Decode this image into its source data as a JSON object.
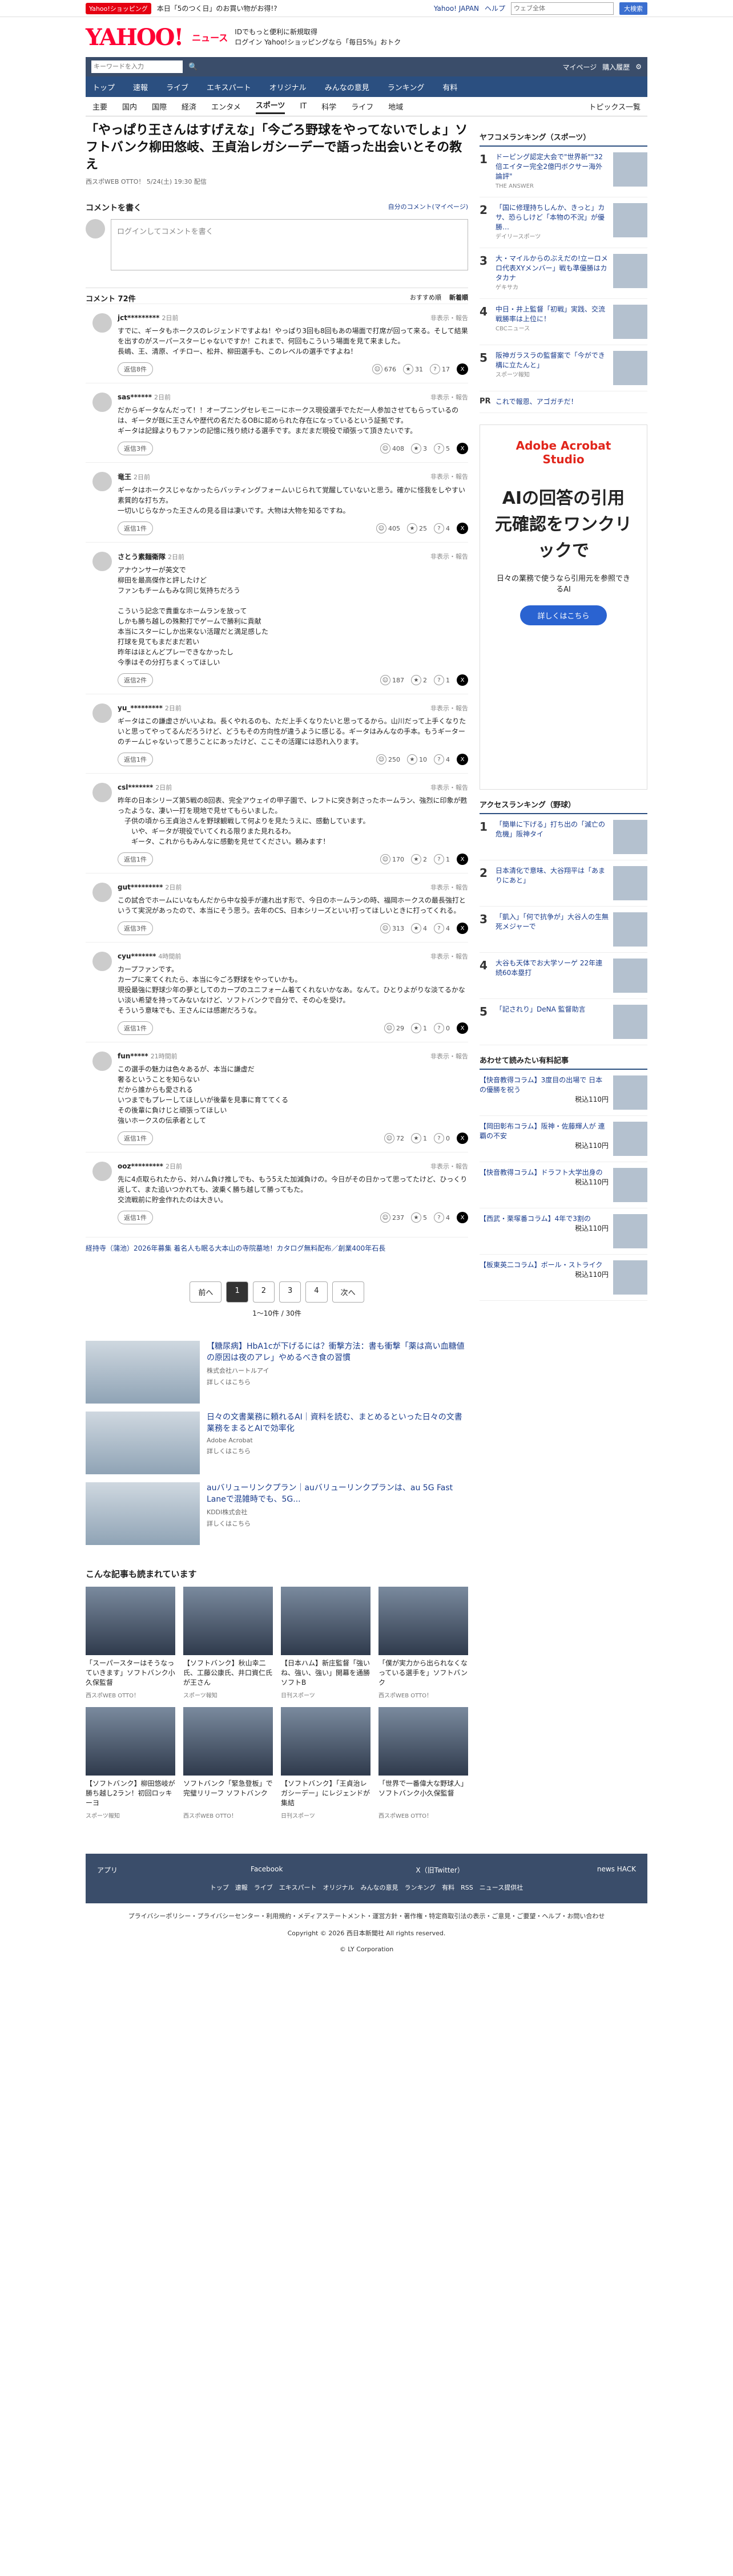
{
  "topline": {
    "badge": "Yahoo!ショッピング",
    "promo": "本日「5のつく日」のお買い物がお得!?",
    "links": [
      "Yahoo! JAPAN",
      "ヘルプ"
    ],
    "search_placeholder": "ウェブ全体",
    "search_btn": "大検索"
  },
  "header": {
    "logo": "YAHOO!",
    "logo_sub": "ニュース",
    "line1": "IDでもっと便利に新規取得",
    "line2": "ログイン Yahoo!ショッピングなら「毎日5%」おトク"
  },
  "navbar": {
    "search_placeholder": "キーワードを入力",
    "links": [
      "マイページ",
      "購入履歴"
    ]
  },
  "tabs": [
    "トップ",
    "速報",
    "ライブ",
    "エキスパート",
    "オリジナル",
    "みんなの意見",
    "ランキング",
    "有料"
  ],
  "subnav": {
    "items": [
      "主要",
      "国内",
      "国際",
      "経済",
      "エンタメ",
      "スポーツ",
      "IT",
      "科学",
      "ライフ",
      "地域"
    ],
    "topics": "トピックス一覧"
  },
  "article": {
    "title": "「やっぱり王さんはすげえな」「今ごろ野球をやってないでしょ」ソフトバンク柳田悠岐、王貞治レガシーデーで語った出会いとその教え",
    "meta": "西スポWEB OTTO！ 5/24(土) 19:30 配信"
  },
  "comment_form": {
    "title": "コメントを書く",
    "right": "自分のコメント(マイページ)",
    "placeholder": "ログインしてコメントを書く"
  },
  "comment_list": {
    "title": "コメント 72件",
    "sort1": "おすすめ順",
    "sort2": "新着順"
  },
  "comments": [
    {
      "user": "jct*********",
      "time": "2日前",
      "report": "非表示・報告",
      "text": "すでに、ギータもホークスのレジェンドですよね！やっぱり3回も8回もあの場面で打席が回って来る。そして結果を出すのがスーパースターじゃないですか！これまで、何回もこういう場面を見て来ました。\n長嶋、王、清原、イチロー、松井、柳田選手も、このレベルの選手ですよね！",
      "reply": "返信8件",
      "r1": "676",
      "r2": "31",
      "r3": "17"
    },
    {
      "user": "sas******",
      "time": "2日前",
      "report": "非表示・報告",
      "text": "だからギータなんだって！！オープニングセレモニーにホークス現役選手でただ一人参加させてもらっているのは、ギータが既に王さんや歴代の名だたるOBに認められた存在になっているという証拠です。\nギータは記録よりもファンの記憶に残り続ける選手です。まだまだ現役で頑張って頂きたいです。",
      "reply": "返信3件",
      "r1": "408",
      "r2": "3",
      "r3": "5"
    },
    {
      "user": "竜王",
      "time": "2日前",
      "report": "非表示・報告",
      "text": "ギータはホークスじゃなかったらバッティングフォームいじられて覚醒していないと思う。確かに怪我をしやすい素質的な打ち方。\n一切いじらなかった王さんの見る目は凄いです。大物は大物を知るですね。",
      "reply": "返信1件",
      "r1": "405",
      "r2": "25",
      "r3": "4"
    },
    {
      "user": "さとう素麺衛隊",
      "time": "2日前",
      "report": "非表示・報告",
      "text": "アナウンサーが英文で\n柳田を最高傑作と評したけど\nファンもチームもみな同じ気持ちだろう\n\nこういう記念で貴重なホームランを放って\nしかも勝ち越しの殊勲打でゲームで勝利に貢献\n本当にスターにしか出来ない活躍だと満足感した\n打球を見てもまだまだ若い\n昨年はほとんどプレーできなかったし\n今季はその分打ちまくってほしい",
      "reply": "返信2件",
      "r1": "187",
      "r2": "2",
      "r3": "1"
    },
    {
      "user": "yu_*********",
      "time": "2日前",
      "report": "非表示・報告",
      "text": "ギータはこの謙虚さがいいよね。長くやれるのも、ただ上手くなりたいと思ってるから。山川だって上手くなりたいと思ってやってるんだろうけど、どうもその方向性が違うように感じる。ギータはみんなの手本。もうギーターのチームじゃないって思うことにあったけど、ここその活躍には恐れ入ります。",
      "reply": "返信1件",
      "r1": "250",
      "r2": "10",
      "r3": "4"
    },
    {
      "user": "csl*******",
      "time": "2日前",
      "report": "非表示・報告",
      "text": "昨年の日本シリーズ第5戦の8回表、完全アウェイの甲子園で、レフトに突き刺さったホームラン、強烈に印象が甦ったような、凄い一打を現地で見せてもらいました。\n　子供の頃から王貞治さんを野球観戦して何よりを見たうえに、感動しています。\n　　いや、ギータが現役でいてくれる限りまた見れるわ。\n　　ギータ、これからもみんなに感動を見せてください。頼みます！",
      "reply": "返信1件",
      "r1": "170",
      "r2": "2",
      "r3": "1"
    },
    {
      "user": "gut*********",
      "time": "2日前",
      "report": "非表示・報告",
      "text": "この試合でホームにいなもんだから中な投手が連れ出す形で、今日のホームランの時、福岡ホークスの最長強打というて実況があったので、本当にそう思う。去年のCS、日本シリーズといい打ってほしいときに打ってくれる。",
      "reply": "返信3件",
      "r1": "313",
      "r2": "4",
      "r3": "4"
    },
    {
      "user": "cyu*******",
      "time": "4時間前",
      "report": "非表示・報告",
      "text": "カープファンです。\nカープに来てくれたら、本当に今ごろ野球をやっていかも。\n現役最強に野球少年の夢としてのカープのユニフォーム着てくれないかなあ。なんて。ひとりよがりな淡てるかない淡い希望を持ってみないなけど、ソフトバンクで自分で、その心を受け。\nそういう意味でも、王さんには感謝だろうな。",
      "reply": "返信1件",
      "r1": "29",
      "r2": "1",
      "r3": "0"
    },
    {
      "user": "fun*****",
      "time": "21時間前",
      "report": "非表示・報告",
      "text": "この選手の魅力は色々あるが、本当に謙虚だ\n奢るということを知らない\nだから誰からも愛される\nいつまでもプレーしてほしいが後輩を見事に育ててくる\nその後輩に負けじと頑張ってほしい\n強いホークスの伝承者として",
      "reply": "返信1件",
      "r1": "72",
      "r2": "1",
      "r3": "0"
    },
    {
      "user": "ooz*********",
      "time": "2日前",
      "report": "非表示・報告",
      "text": "先に4点取られたから、対ハム負け推しでも、もう5えた加減負けの。今日がその日かって思ってたけど、ひっくり返して、また追いつかれても、波乗く勝ち越して勝ってもた。\n交流戦前に貯金作れたのは大きい。",
      "reply": "返信1件",
      "r1": "237",
      "r2": "5",
      "r3": "4"
    }
  ],
  "ad_line": "経持寺（蒲池）2026年募集 着名人も眠る大本山の寺院墓地！カタログ無料配布／創業400年石長",
  "pager": {
    "prev": "前へ",
    "pages": [
      "1",
      "2",
      "3",
      "4"
    ],
    "next": "次へ",
    "info": "1〜10件 / 30件"
  },
  "recs": [
    {
      "title": "【糖尿病】HbA1cが下げるには？衝撃方法：書も衝撃「薬は高い血糖値の原因は夜のアレ」やめるべき食の習慣",
      "sub": "株式会社ハートルアイ",
      "cta": "詳しくはこちら"
    },
    {
      "title": "日々の文書業務に頼れるAI｜資料を読む、まとめるといった日々の文書業務をまるとAIで効率化",
      "sub": "Adobe Acrobat",
      "cta": "詳しくはこちら"
    },
    {
      "title": "auバリューリンクプラン｜auバリューリンクプランは、au 5G Fast Laneで混雑時でも、5G...",
      "sub": "KDDI株式会社",
      "cta": "詳しくはこちら"
    }
  ],
  "grid_title": "こんな記事も読まれています",
  "grid": [
    {
      "t": "「スーパースターはそうなっていきます」ソフトバンク小久保監督",
      "s": "西スポWEB OTTO！"
    },
    {
      "t": "【ソフトバンク】秋山幸二氏、工藤公康氏、井口資仁氏が王さん",
      "s": "スポーツ報知"
    },
    {
      "t": "【日本ハム】新庄監督「強いね、強い、強い」開幕を通勝ソフトB",
      "s": "日刊スポーツ"
    },
    {
      "t": "「僕が実力から出られなくなっている選手を」ソフトバンク",
      "s": "西スポWEB OTTO！"
    },
    {
      "t": "【ソフトバンク】柳田悠岐が勝ち越し2ラン！初回ロッキーヨ",
      "s": "スポーツ報知"
    },
    {
      "t": "ソフトバンク「緊急登板」で完璧リリーフ ソフトバンク",
      "s": "西スポWEB OTTO！"
    },
    {
      "t": "【ソフトバンク】「王貞治レガシーデー」にレジェンドが集結",
      "s": "日刊スポーツ"
    },
    {
      "t": "「世界で一番偉大な野球人」ソフトバンク小久保監督",
      "s": "西スポWEB OTTO！"
    }
  ],
  "side": {
    "rank_title": "ヤフコメランキング（スポーツ）",
    "ranks": [
      {
        "n": "1",
        "t": "ドーピング認定大会で\"世界新\"\"32倍エイター完全2億円ボクサー海外論評\"",
        "c": "THE ANSWER"
      },
      {
        "n": "2",
        "t": "「国に修理持ちしんか、きっと」カサ、恐らしけど「本物の不況」が優勝…",
        "c": "デイリースポーツ"
      },
      {
        "n": "3",
        "t": "大・マイルからのぶえだの!立ーロメロ代表XYメンバー」戦も準優勝はカタカナ",
        "c": "ゲキサカ"
      },
      {
        "n": "4",
        "t": "中日・井上監督「初戦」実践、交流戦勝率は上位に！",
        "c": "CBCニュース"
      },
      {
        "n": "5",
        "t": "阪神ガラスラの監督案で「今ができ構に立たんと」",
        "c": "スポーツ報知"
      }
    ],
    "pr": "これで報恩、アゴガチだ！",
    "ad_brand": "Adobe Acrobat Studio",
    "ad_headline": "AIの回答の引用元確認をワンクリックで",
    "ad_sub": "日々の業務で使うなら引用元を参照できるAI",
    "ad_cta": "詳しくはこちら",
    "access_title": "アクセスランキング（野球）",
    "access": [
      {
        "n": "1",
        "t": "「簡単に下げる」打ち出の「滅亡の危機」阪神タイ"
      },
      {
        "n": "2",
        "t": "日本清化で意味、大谷翔平は「あまりにあと」"
      },
      {
        "n": "3",
        "t": "「凱入」「何で抗争が」大谷人の生無死メジャーで"
      },
      {
        "n": "4",
        "t": "大谷も天体でお大学ソーゲ 22年連続60本塁打"
      },
      {
        "n": "5",
        "t": "「記されり」DeNA 監督助言"
      }
    ],
    "paid_title": "あわせて読みたい有料記事",
    "paid": [
      {
        "t": "【快音教得コラム】3度目の出場で 日本の優勝を祝う",
        "p": "税込110円"
      },
      {
        "t": "【岡田彰布コラム】阪神・佐藤輝人が 連覇の不安",
        "p": "税込110円"
      },
      {
        "t": "【快音教得コラム】ドラフト大学出身の",
        "p": "税込110円"
      },
      {
        "t": "【西武・栗塚番コラム】4年で3割の",
        "p": "税込110円"
      },
      {
        "t": "【板東英二コラム】ボール・ストライク",
        "p": "税込110円"
      }
    ]
  },
  "footer": {
    "items": [
      "アプリ",
      "Facebook",
      "X（旧Twitter）",
      "news HACK"
    ],
    "nav": "トップ　速報　ライブ　エキスパート　オリジナル　みんなの意見　ランキング　有料　RSS　ニュース提供社",
    "links": "プライバシーポリシー・プライバシーセンター・利用規約・メディアステートメント・運営方針・著作権・特定商取引法の表示・ご意見・ご要望・ヘルプ・お問い合わせ",
    "copy": "Copyright © 2026 西日本新聞社 All rights reserved.",
    "corp": "© LY Corporation"
  }
}
